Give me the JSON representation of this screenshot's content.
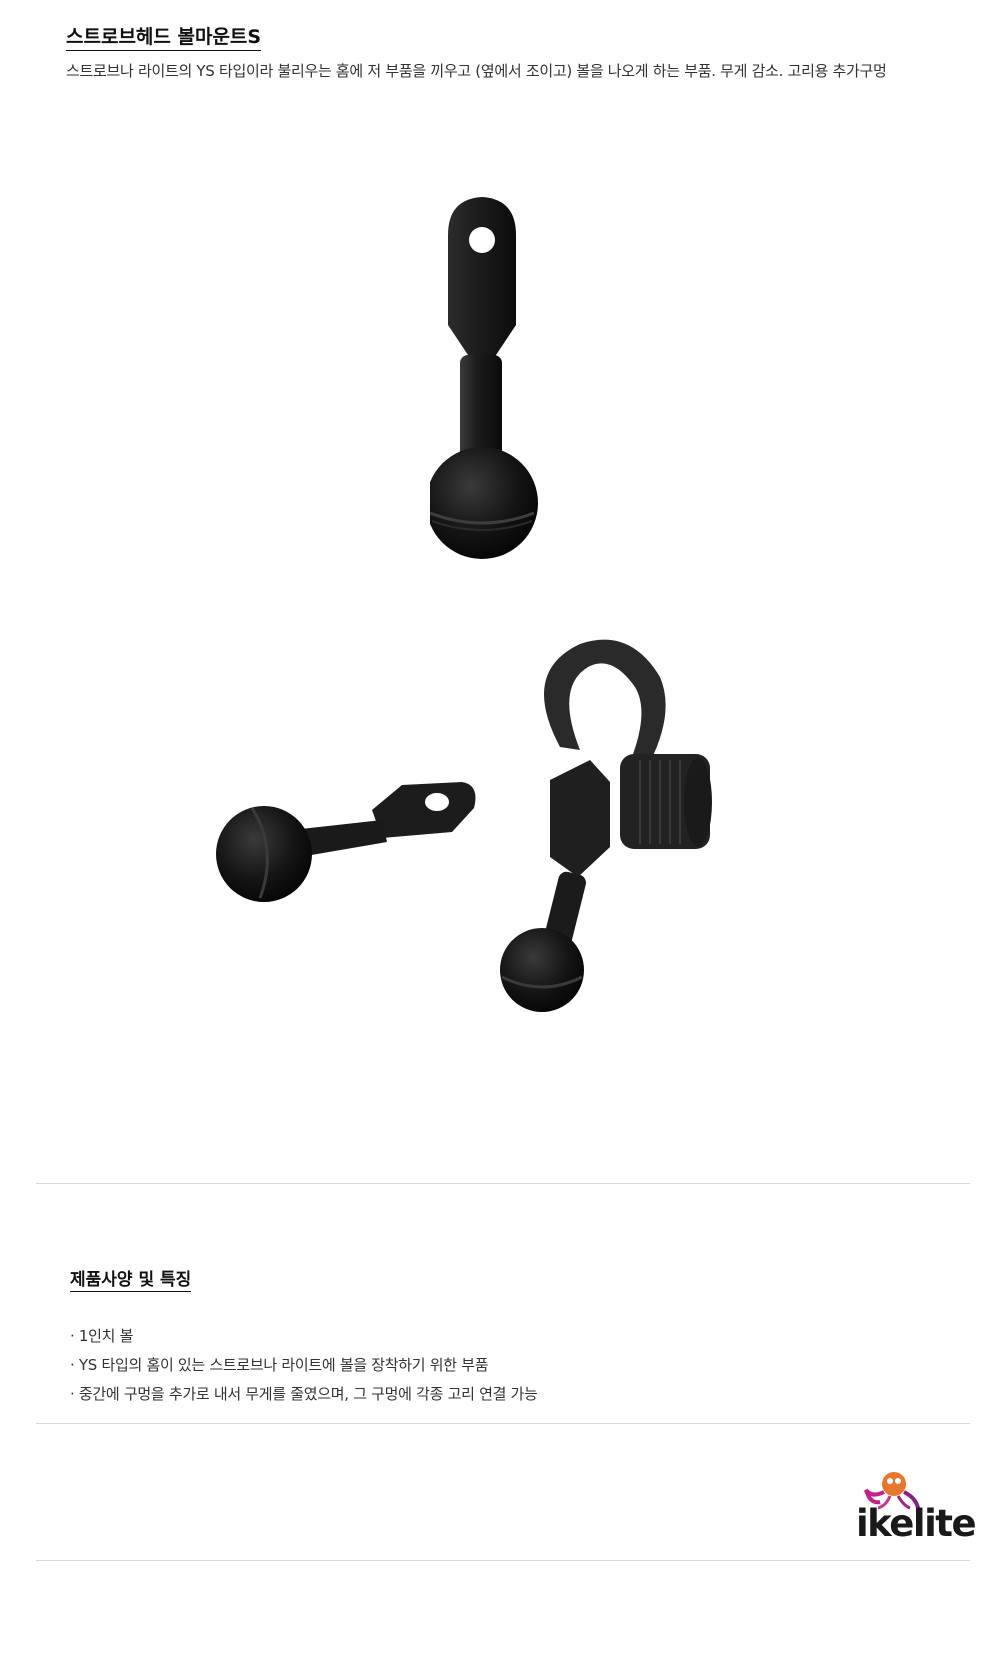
{
  "header": {
    "title": "스트로브헤드 볼마운트S",
    "description": "스트로브나 라이트의 YS 타입이라 불리우는 홈에 저 부품을 끼우고 (옆에서 조이고) 볼을 나오게 하는 부품. 무게 감소. 고리용 추가구멍"
  },
  "specs": {
    "title": "제품사양 및 특징",
    "items": [
      "· 1인치 볼",
      "· YS 타입의 홈이 있는 스트로브나 라이트에 볼을 장착하기 위한 부품",
      "· 중간에 구멍을 추가로 내서 무게를 줄였으며, 그 구멍에 각종 고리 연결 가능"
    ]
  },
  "brand": {
    "logo_text": "ikelite"
  }
}
